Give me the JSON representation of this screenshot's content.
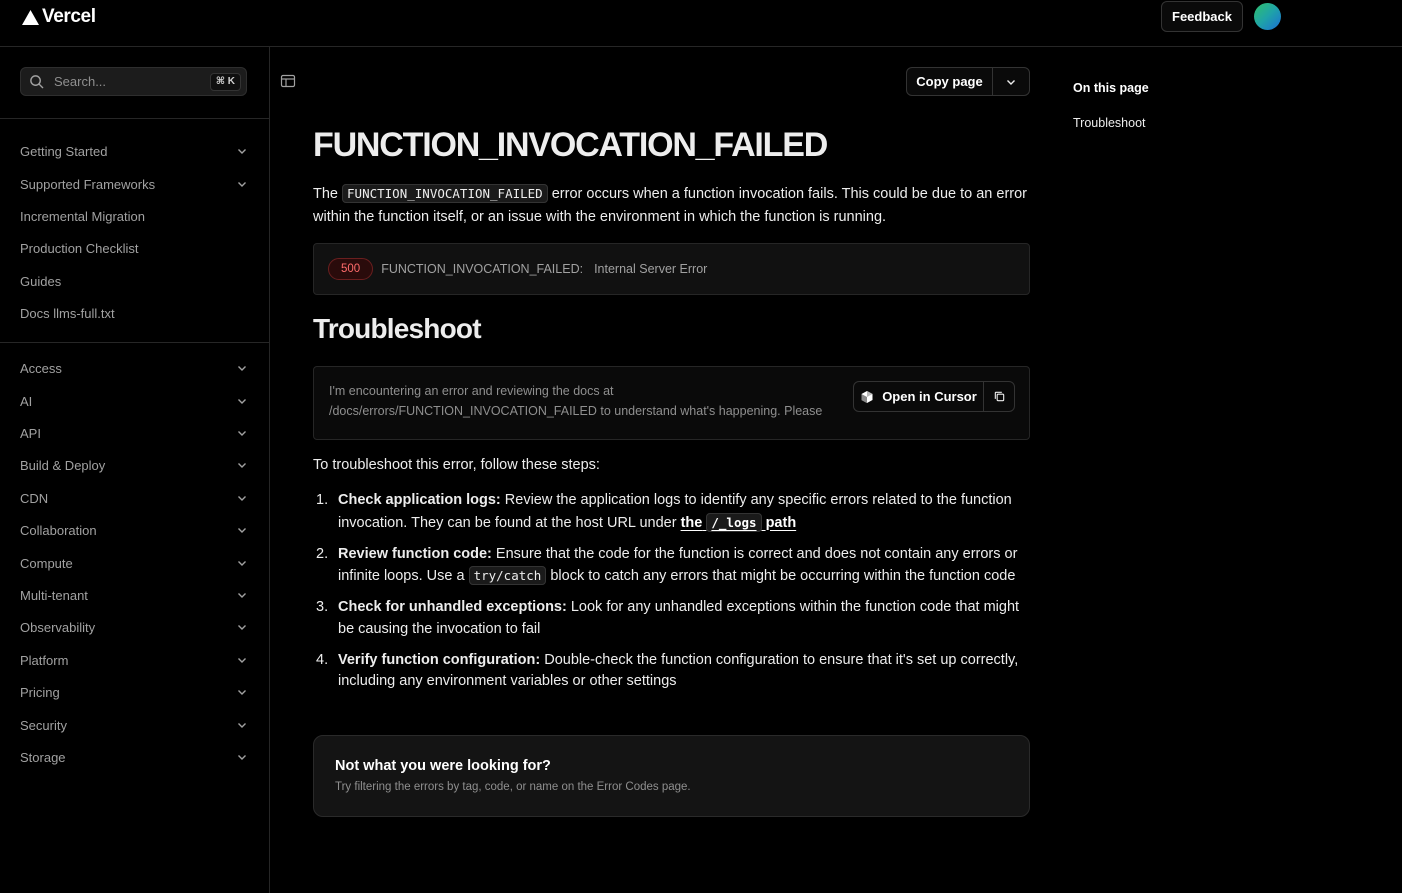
{
  "header": {
    "brand": "Vercel",
    "feedback_label": "Feedback"
  },
  "sidebar": {
    "search_placeholder": "Search...",
    "search_shortcut": "⌘ K",
    "group1": [
      {
        "label": "Getting Started",
        "expandable": true
      },
      {
        "label": "Supported Frameworks",
        "expandable": true
      },
      {
        "label": "Incremental Migration",
        "expandable": false
      },
      {
        "label": "Production Checklist",
        "expandable": false
      },
      {
        "label": "Guides",
        "expandable": false
      },
      {
        "label": "Docs llms-full.txt",
        "expandable": false
      }
    ],
    "group2": [
      {
        "label": "Access"
      },
      {
        "label": "AI"
      },
      {
        "label": "API"
      },
      {
        "label": "Build & Deploy"
      },
      {
        "label": "CDN"
      },
      {
        "label": "Collaboration"
      },
      {
        "label": "Compute"
      },
      {
        "label": "Multi-tenant"
      },
      {
        "label": "Observability"
      },
      {
        "label": "Platform"
      },
      {
        "label": "Pricing"
      },
      {
        "label": "Security"
      },
      {
        "label": "Storage"
      }
    ]
  },
  "main": {
    "copy_page_label": "Copy page",
    "title": "FUNCTION_INVOCATION_FAILED",
    "intro_prefix": "The",
    "intro_code": "FUNCTION_INVOCATION_FAILED",
    "intro_suffix": "error occurs when a function invocation fails. This could be due to an error within the function itself, or an issue with the environment in which the function is running.",
    "error_box": {
      "status": "500",
      "code": "FUNCTION_INVOCATION_FAILED:",
      "description": "Internal Server Error"
    },
    "section_title": "Troubleshoot",
    "prompt_text": "I'm encountering an error and reviewing the docs at /docs/errors/FUNCTION_INVOCATION_FAILED to understand what's happening. Please",
    "open_in_cursor_label": "Open in Cursor",
    "steps_intro": "To troubleshoot this error, follow these steps:",
    "steps": [
      {
        "num": "1.",
        "title": "Check application logs:",
        "text": "Review the application logs to identify any specific errors related to the function invocation. They can be found at the host URL under",
        "link_pre": "the",
        "link_code": "/_logs",
        "link_post": "path"
      },
      {
        "num": "2.",
        "title": "Review function code:",
        "text_a": "Ensure that the code for the function is correct and does not contain any errors or infinite loops. Use a",
        "code": "try/catch",
        "text_b": "block to catch any errors that might be occurring within the function code"
      },
      {
        "num": "3.",
        "title": "Check for unhandled exceptions:",
        "text": "Look for any unhandled exceptions within the function code that might be causing the invocation to fail"
      },
      {
        "num": "4.",
        "title": "Verify function configuration:",
        "text": "Double-check the function configuration to ensure that it's set up correctly, including any environment variables or other settings"
      }
    ],
    "not_found": {
      "title": "Not what you were looking for?",
      "subtitle": "Try filtering the errors by tag, code, or name on the Error Codes page."
    }
  },
  "toc": {
    "title": "On this page",
    "items": [
      "Troubleshoot"
    ]
  },
  "colors": {
    "background": "#000000",
    "text": "#ededed",
    "muted": "#a1a1a1",
    "error_badge": "#ff6b6b"
  }
}
